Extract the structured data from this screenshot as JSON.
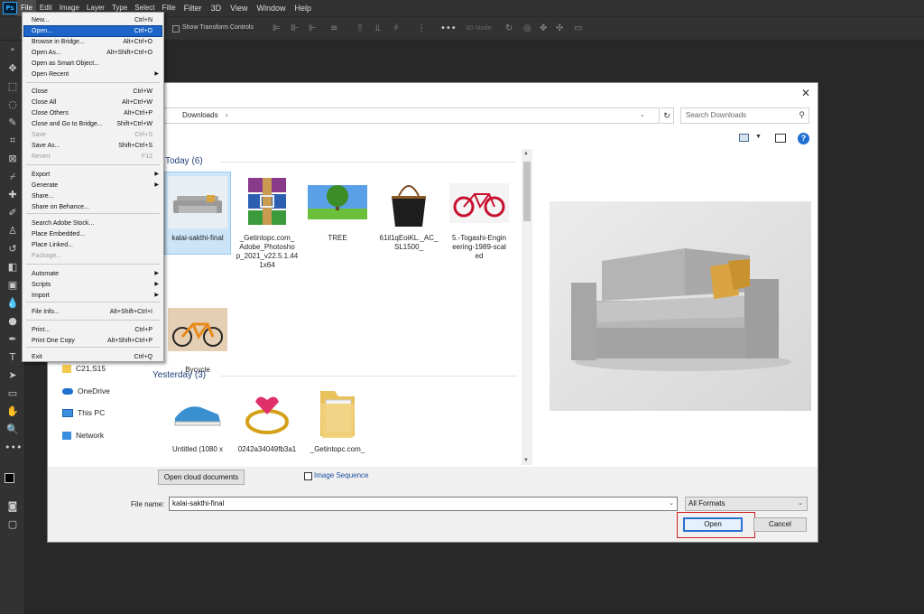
{
  "app": {
    "logo": "Ps"
  },
  "menubar": {
    "items": [
      "File",
      "Edit",
      "Image",
      "Layer",
      "Type",
      "Select",
      "Filte",
      "Filter",
      "3D",
      "View",
      "Window",
      "Help"
    ]
  },
  "options_bar": {
    "show_transform_label": "Show Transform Controls",
    "mode_3d_label": "3D Mode:"
  },
  "file_menu": {
    "items": [
      {
        "label": "New...",
        "shortcut": "Ctrl+N"
      },
      {
        "label": "Open...",
        "shortcut": "Ctrl+O",
        "highlighted": true
      },
      {
        "label": "Browse in Bridge...",
        "shortcut": "Alt+Ctrl+O"
      },
      {
        "label": "Open As...",
        "shortcut": "Alt+Shift+Ctrl+O"
      },
      {
        "label": "Open as Smart Object..."
      },
      {
        "label": "Open Recent",
        "submenu": true
      },
      {
        "label": "Close",
        "shortcut": "Ctrl+W"
      },
      {
        "label": "Close All",
        "shortcut": "Alt+Ctrl+W"
      },
      {
        "label": "Close Others",
        "shortcut": "Alt+Ctrl+P"
      },
      {
        "label": "Close and Go to Bridge...",
        "shortcut": "Shift+Ctrl+W"
      },
      {
        "label": "Save",
        "shortcut": "Ctrl+S",
        "disabled": true
      },
      {
        "label": "Save As...",
        "shortcut": "Shift+Ctrl+S"
      },
      {
        "label": "Revert",
        "shortcut": "F12",
        "disabled": true
      },
      {
        "label": "Export",
        "submenu": true
      },
      {
        "label": "Generate",
        "submenu": true
      },
      {
        "label": "Share..."
      },
      {
        "label": "Share on Behance..."
      },
      {
        "label": "Search Adobe Stock..."
      },
      {
        "label": "Place Embedded..."
      },
      {
        "label": "Place Linked..."
      },
      {
        "label": "Package...",
        "disabled": true
      },
      {
        "label": "Automate",
        "submenu": true
      },
      {
        "label": "Scripts",
        "submenu": true
      },
      {
        "label": "Import",
        "submenu": true
      },
      {
        "label": "File Info...",
        "shortcut": "Alt+Shift+Ctrl+I"
      },
      {
        "label": "Print...",
        "shortcut": "Ctrl+P"
      },
      {
        "label": "Print One Copy",
        "shortcut": "Alt+Shift+Ctrl+P"
      },
      {
        "label": "Exit",
        "shortcut": "Ctrl+Q"
      }
    ]
  },
  "dialog": {
    "breadcrumb": "Downloads",
    "search_placeholder": "Search Downloads",
    "nav": [
      {
        "label": "C21,S15",
        "icon": "folder-icon"
      },
      {
        "label": "OneDrive",
        "icon": "cloud-icon"
      },
      {
        "label": "This PC",
        "icon": "computer-icon"
      },
      {
        "label": "Network",
        "icon": "network-icon"
      }
    ],
    "groups": [
      {
        "header": "Today (6)",
        "files": [
          {
            "name": "kalai-sakthi-final",
            "thumb": "sofa",
            "selected": true
          },
          {
            "name": "_Getintopc.com_Adobe_Photoshop_2021_v22.5.1.441x64",
            "display": [
              "_Getintopc.com_",
              "Adobe_Photosho",
              "p_2021_v22.5.1.44",
              "1x64"
            ],
            "thumb": "winrar"
          },
          {
            "name": "TREE",
            "thumb": "tree"
          },
          {
            "name": "61il1qEoiKL._AC_SL1500_",
            "display": [
              "61il1qEoiKL._AC_",
              "SL1500_"
            ],
            "thumb": "bag"
          },
          {
            "name": "5.-Togashi-Engineering-1989-scaled",
            "display": [
              "5.-Togashi-Engin",
              "eering-1989-scal",
              "ed"
            ],
            "thumb": "bike-red"
          },
          {
            "name": "Bycycle",
            "thumb": "bike-orange"
          }
        ]
      },
      {
        "header": "Yesterday (3)",
        "files": [
          {
            "name": "Untitled (1080 x",
            "thumb": "shoe"
          },
          {
            "name": "0242a34049fb3a1",
            "thumb": "ring"
          },
          {
            "name": "_Getintopc.com_",
            "thumb": "folder"
          }
        ]
      }
    ],
    "cloud_button": "Open cloud documents",
    "image_sequence_label": "Image Sequence",
    "file_name_label": "File name:",
    "file_name_value": "kalai-sakthi-final",
    "format_value": "All Formats",
    "open_button": "Open",
    "cancel_button": "Cancel"
  },
  "colors": {
    "ps_bg": "#282828",
    "menu_highlight": "#1d64c8",
    "open_highlight": "#d32020",
    "group_header": "#1e3f7a"
  }
}
